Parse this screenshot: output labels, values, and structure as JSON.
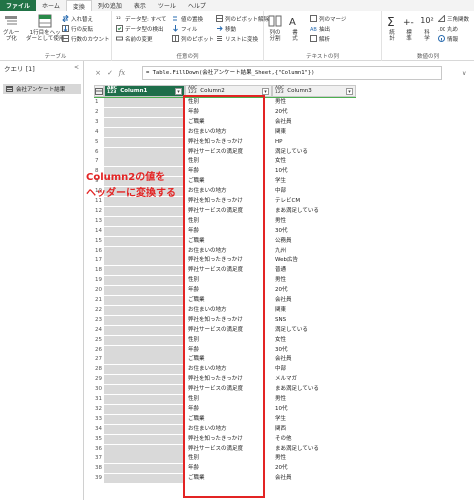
{
  "menu": {
    "tabs": [
      "ファイル",
      "ホーム",
      "変換",
      "列の追加",
      "表示",
      "ツール",
      "ヘルプ"
    ]
  },
  "ribbon": {
    "groups": {
      "table_label": "テーブル",
      "any_column_label": "任意の列",
      "text_column_label": "テキストの列",
      "number_column_label": "数値の列"
    },
    "group_button": "グルー\nプ化",
    "first_row_header": "1行目をヘッ\nダーとして使用",
    "swap_rows": "入れ替え",
    "reverse_rows": "行の反転",
    "count_rows": "行数のカウント",
    "data_type": "データ型: すべて",
    "detect_type": "データ型の検出",
    "rename": "名前の変更",
    "replace_values": "値の置換",
    "fill": "フィル",
    "move": "移動",
    "unpivot": "列のピボット解除",
    "pivot": "列のピボット",
    "to_list": "リストに変換",
    "split_column": "列の\n分割",
    "format": "書\n式",
    "merge_columns": "列のマージ",
    "extract": "抽出",
    "parse": "解析",
    "statistics": "統\n計",
    "standard": "標\n準",
    "scientific": "科\n学",
    "trig": "三角関数",
    "rounding": "丸め",
    "information": "情報",
    "ten_power": "10²"
  },
  "query_pane": {
    "title": "クエリ [1]",
    "item": "会社アンケート結果",
    "collapse": "<"
  },
  "formula_bar": {
    "cancel": "×",
    "confirm": "✓",
    "fx": "fx",
    "formula": "= Table.FillDown(会社アンケート結果_Sheet,{\"Column1\"})",
    "expand": "∨"
  },
  "grid": {
    "columns": [
      {
        "name": "Column1",
        "type": "ABC\n123"
      },
      {
        "name": "Column2",
        "type": "ABC\n123"
      },
      {
        "name": "Column3",
        "type": "ABC\n123"
      }
    ],
    "rows": [
      [
        "1",
        "",
        "性別",
        "男性"
      ],
      [
        "2",
        "",
        "年齢",
        "20代"
      ],
      [
        "3",
        "",
        "ご職業",
        "会社員"
      ],
      [
        "4",
        "",
        "お住まいの地方",
        "関東"
      ],
      [
        "5",
        "",
        "弊社を知ったきっかけ",
        "HP"
      ],
      [
        "6",
        "",
        "弊社サービスの満足度",
        "満足している"
      ],
      [
        "7",
        "",
        "性別",
        "女性"
      ],
      [
        "8",
        "",
        "年齢",
        "10代"
      ],
      [
        "9",
        "",
        "ご職業",
        "学生"
      ],
      [
        "10",
        "",
        "お住まいの地方",
        "中部"
      ],
      [
        "11",
        "",
        "弊社を知ったきっかけ",
        "テレビCM"
      ],
      [
        "12",
        "",
        "弊社サービスの満足度",
        "まあ満足している"
      ],
      [
        "13",
        "",
        "性別",
        "男性"
      ],
      [
        "14",
        "",
        "年齢",
        "30代"
      ],
      [
        "15",
        "",
        "ご職業",
        "公務員"
      ],
      [
        "16",
        "",
        "お住まいの地方",
        "九州"
      ],
      [
        "17",
        "",
        "弊社を知ったきっかけ",
        "Web広告"
      ],
      [
        "18",
        "",
        "弊社サービスの満足度",
        "普通"
      ],
      [
        "19",
        "",
        "性別",
        "男性"
      ],
      [
        "20",
        "",
        "年齢",
        "20代"
      ],
      [
        "21",
        "",
        "ご職業",
        "会社員"
      ],
      [
        "22",
        "",
        "お住まいの地方",
        "関東"
      ],
      [
        "23",
        "",
        "弊社を知ったきっかけ",
        "SNS"
      ],
      [
        "24",
        "",
        "弊社サービスの満足度",
        "満足している"
      ],
      [
        "25",
        "",
        "性別",
        "女性"
      ],
      [
        "26",
        "",
        "年齢",
        "30代"
      ],
      [
        "27",
        "",
        "ご職業",
        "会社員"
      ],
      [
        "28",
        "",
        "お住まいの地方",
        "中部"
      ],
      [
        "29",
        "",
        "弊社を知ったきっかけ",
        "メルマガ"
      ],
      [
        "30",
        "",
        "弊社サービスの満足度",
        "まあ満足している"
      ],
      [
        "31",
        "",
        "性別",
        "男性"
      ],
      [
        "32",
        "",
        "年齢",
        "10代"
      ],
      [
        "33",
        "",
        "ご職業",
        "学生"
      ],
      [
        "34",
        "",
        "お住まいの地方",
        "関西"
      ],
      [
        "35",
        "",
        "弊社を知ったきっかけ",
        "その他"
      ],
      [
        "36",
        "",
        "弊社サービスの満足度",
        "まあ満足している"
      ],
      [
        "37",
        "",
        "性別",
        "男性"
      ],
      [
        "38",
        "",
        "年齢",
        "20代"
      ],
      [
        "39",
        "",
        "ご職業",
        "会社員"
      ]
    ]
  },
  "annotation": {
    "line1": "Column2の値を",
    "line2": "ヘッダーに変換する"
  },
  "colors": {
    "accent": "#217346",
    "highlight": "#e32424",
    "selected_header": "#1e6e4a"
  }
}
